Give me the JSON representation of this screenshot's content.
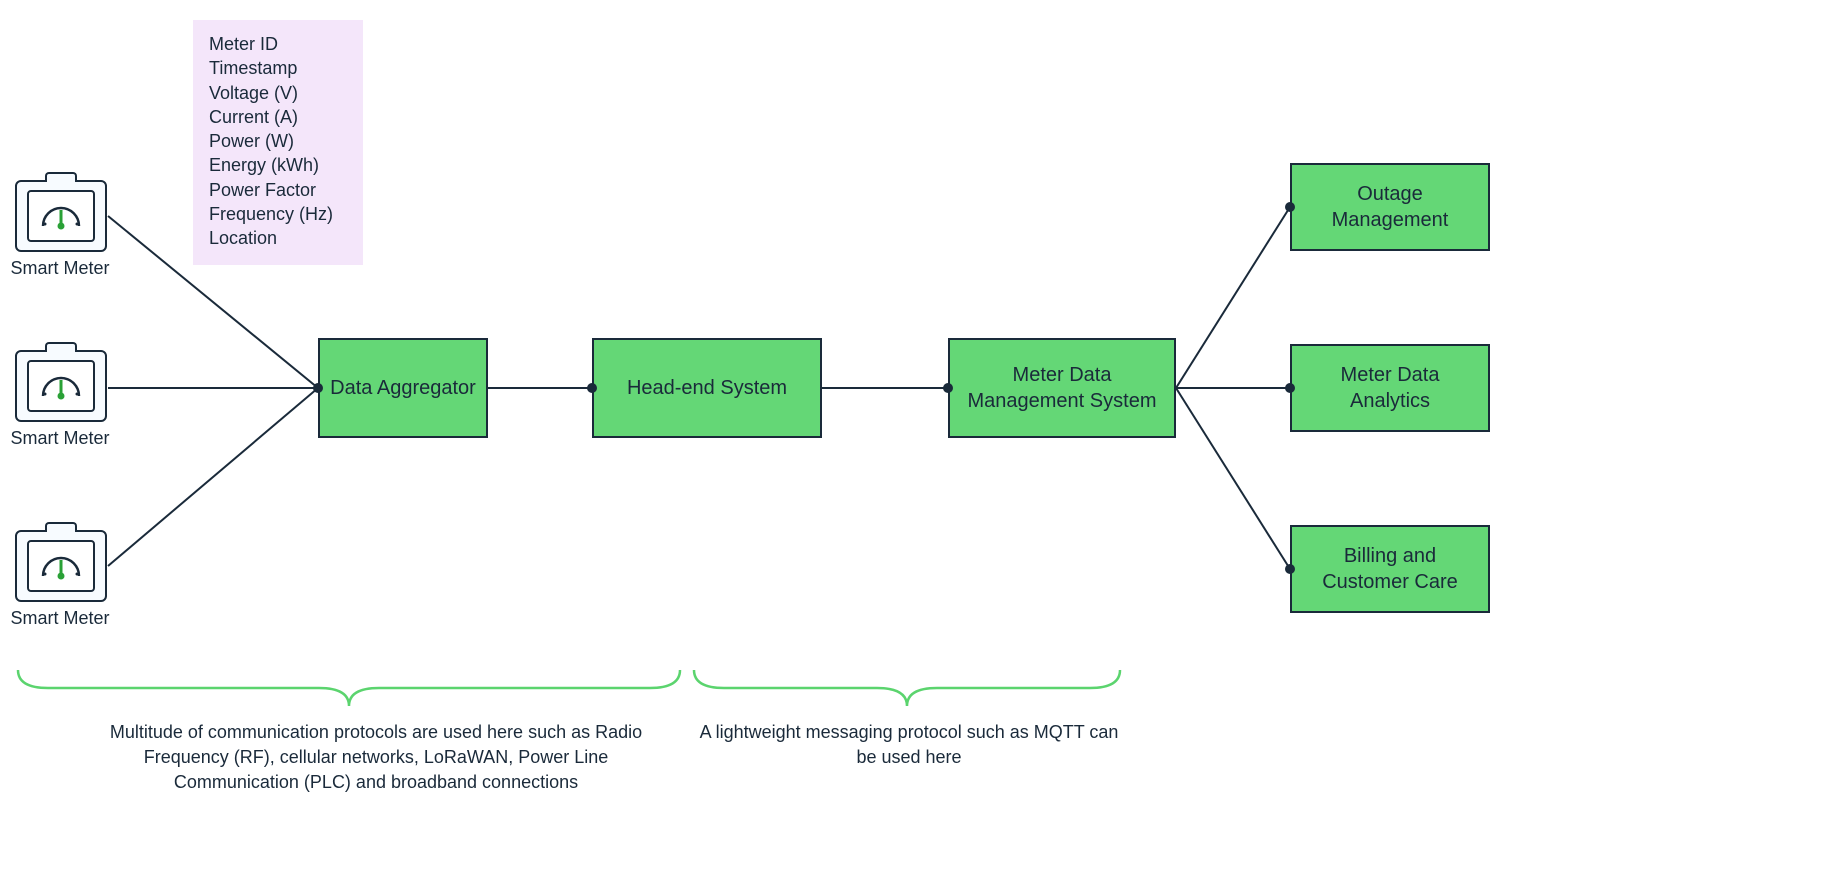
{
  "meters": [
    {
      "label": "Smart Meter"
    },
    {
      "label": "Smart Meter"
    },
    {
      "label": "Smart Meter"
    }
  ],
  "fields": [
    "Meter ID",
    "Timestamp",
    "Voltage (V)",
    "Current (A)",
    "Power (W)",
    "Energy (kWh)",
    "Power Factor",
    "Frequency (Hz)",
    "Location"
  ],
  "nodes": {
    "aggregator": "Data Aggregator",
    "headend": "Head-end System",
    "mdms": "Meter Data Management System",
    "outage": "Outage Management",
    "analytics": "Meter Data Analytics",
    "billing": "Billing and Customer Care"
  },
  "annotations": {
    "left": "Multitude of communication protocols are used here such as Radio Frequency (RF), cellular networks, LoRaWAN, Power Line Communication (PLC) and broadband connections",
    "right": "A lightweight messaging protocol such as MQTT can be used here"
  },
  "colors": {
    "node_fill": "#64d776",
    "node_stroke": "#1a2a3a",
    "meter_tint": "#f7fbff",
    "fields_bg": "#f4e6fa",
    "brace": "#5bd46e",
    "gauge_green": "#2aa136"
  }
}
